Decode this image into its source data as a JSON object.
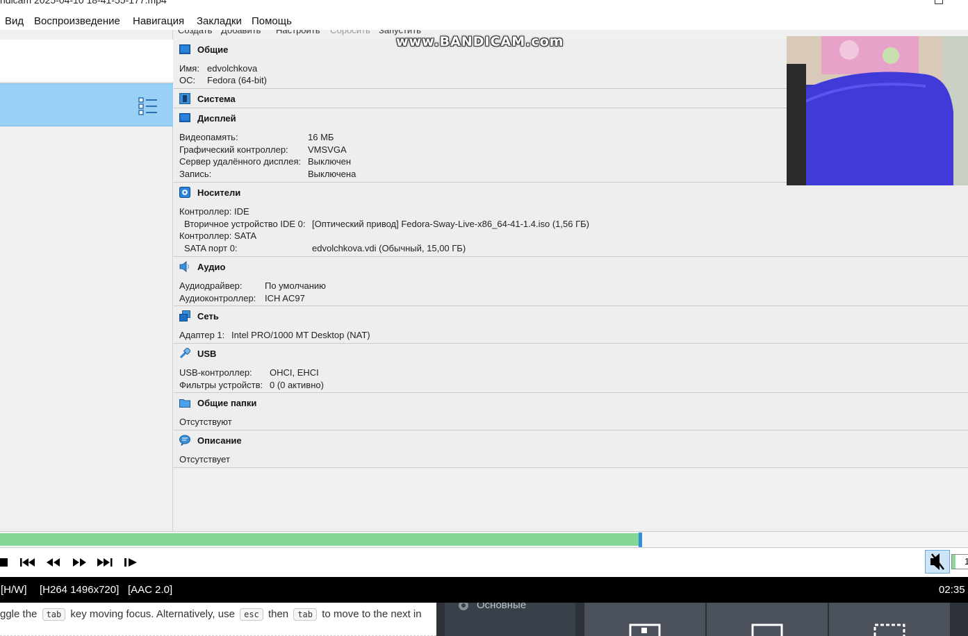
{
  "window": {
    "title": "ndicam 2025-04-10 18-41-55-177.mp4"
  },
  "menu": [
    "Вид",
    "Воспроизведение",
    "Навигация",
    "Закладки",
    "Помощь"
  ],
  "vbox_toolbar": [
    "Создать",
    "Добавить",
    "Настроить",
    "Сбросить",
    "Запустить"
  ],
  "watermark": "www.BANDICAM.com",
  "sections": {
    "general": {
      "title": "Общие",
      "rows": [
        {
          "key": "Имя:",
          "value": "edvolchkova"
        },
        {
          "key": "ОС:",
          "value": "Fedora (64-bit)"
        }
      ]
    },
    "system": {
      "title": "Система"
    },
    "display": {
      "title": "Дисплей",
      "rows": [
        {
          "key": "Видеопамять:",
          "value": "16 МБ"
        },
        {
          "key": "Графический контроллер:",
          "value": "VMSVGA"
        },
        {
          "key": "Сервер удалённого дисплея:",
          "value": "Выключен"
        },
        {
          "key": "Запись:",
          "value": "Выключена"
        }
      ]
    },
    "storage": {
      "title": "Носители",
      "controller_ide": "Контроллер: IDE",
      "ide_device": {
        "key": "Вторичное устройство IDE 0:",
        "value": "[Оптический привод] Fedora-Sway-Live-x86_64-41-1.4.iso (1,56 ГБ)"
      },
      "controller_sata": "Контроллер: SATA",
      "sata_port": {
        "key": "SATA порт 0:",
        "value": "edvolchkova.vdi (Обычный, 15,00 ГБ)"
      }
    },
    "audio": {
      "title": "Аудио",
      "rows": [
        {
          "key": "Аудиодрайвер:",
          "value": "По умолчанию"
        },
        {
          "key": "Аудиоконтроллер:",
          "value": "ICH AC97"
        }
      ]
    },
    "network": {
      "title": "Сеть",
      "rows": [
        {
          "key": "Адаптер 1:",
          "value": "Intel PRO/1000 MT Desktop (NAT)"
        }
      ]
    },
    "usb": {
      "title": "USB",
      "rows": [
        {
          "key": "USB-контроллер:",
          "value": "OHCI, EHCI"
        },
        {
          "key": "Фильтры устройств:",
          "value": "0 (0 активно)"
        }
      ]
    },
    "shared": {
      "title": "Общие папки",
      "text": "Отсутствуют"
    },
    "description": {
      "title": "Описание",
      "text": "Отсутствует"
    }
  },
  "player": {
    "progress": 0.66,
    "volume_label": "1",
    "status": {
      "hw": "[H/W]",
      "video": "[H264 1496x720]",
      "audio": "[AAC 2.0]",
      "time": "02:35 /"
    }
  },
  "hint": {
    "part1": "ggle the",
    "key1": "tab",
    "part2": "key moving focus. Alternatively, use",
    "key2": "esc",
    "part3": "then",
    "key3": "tab",
    "part4": "to move to the next in"
  },
  "bg_app": {
    "label": "Основные"
  },
  "colors": {
    "seek_fill": "#83d696",
    "seek_handle": "#2f8fd8",
    "selection": "#99d0f5",
    "statusbar": "#000000"
  }
}
